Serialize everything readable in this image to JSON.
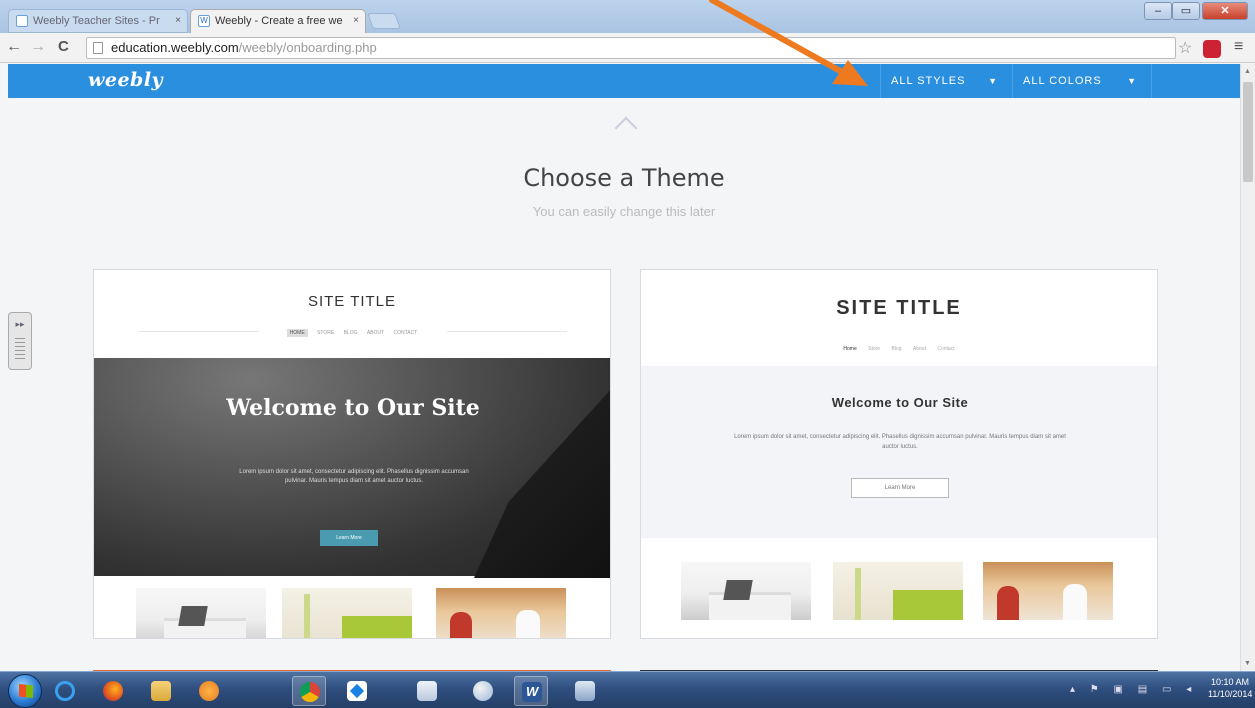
{
  "browser": {
    "tabs": [
      {
        "label": "Weebly Teacher Sites - Pr",
        "active": false
      },
      {
        "label": "Weebly - Create a free we",
        "active": true
      }
    ],
    "tab_close_glyph": "×",
    "window_controls": {
      "minimize": "–",
      "maximize": "▭",
      "close": "✕"
    },
    "nav": {
      "back": "←",
      "forward": "→",
      "reload": "C"
    },
    "url_host": "education.weebly.com",
    "url_path": "/weebly/onboarding.php",
    "star_glyph": "☆",
    "menu_glyph": "≡"
  },
  "header": {
    "logo": "weebly",
    "filters": [
      {
        "label": "ALL STYLES",
        "caret": "▼"
      },
      {
        "label": "ALL COLORS",
        "caret": "▼"
      }
    ],
    "bar_color": "#2b8fe0"
  },
  "main": {
    "title": "Choose a Theme",
    "subtitle": "You can easily change this later"
  },
  "themes": [
    {
      "site_title": "SITE TITLE",
      "nav": [
        "HOME",
        "STORE",
        "BLOG",
        "ABOUT",
        "CONTACT"
      ],
      "welcome": "Welcome to Our Site",
      "body": "Lorem ipsum dolor sit amet, consectetur adipiscing elit. Phasellus dignissim accumsan pulvinar. Mauris tempus diam sit amet auctor luctus.",
      "button": "Learn More"
    },
    {
      "site_title": "SITE TITLE",
      "nav": [
        "Home",
        "Store",
        "Blog",
        "About",
        "Contact"
      ],
      "welcome": "Welcome to Our Site",
      "body": "Lorem ipsum dolor sit amet, consectetur adipiscing elit. Phasellus dignissim accumsan pulvinar. Mauris tempus diam sit amet auctor luctus.",
      "button": "Learn More"
    }
  ],
  "sidebar_widget": {
    "glyph": "▸▸"
  },
  "taskbar": {
    "tray_icons": "▴ ⚑ ▣ ▤ ▭ ◂",
    "time": "10:10 AM",
    "date": "11/10/2014"
  },
  "colors": {
    "accent": "#2b8fe0",
    "arrow": "#ee7a1f",
    "theme1_button": "#4a9bb0"
  }
}
